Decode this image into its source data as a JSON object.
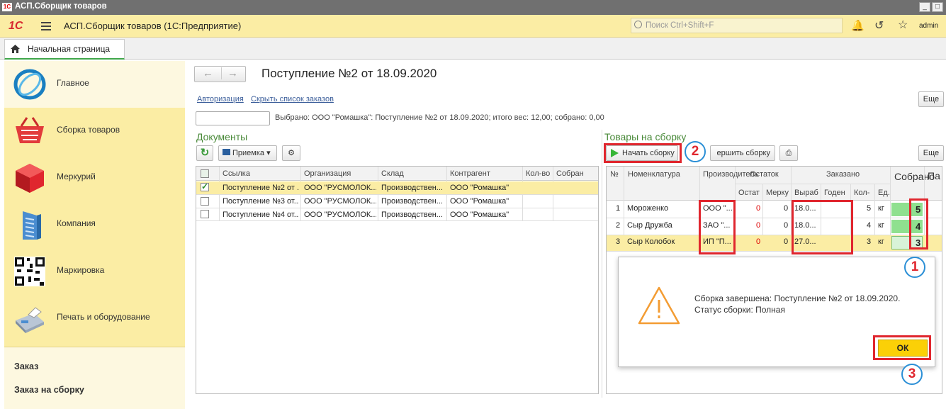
{
  "window": {
    "title": "АСП.Сборщик товаров",
    "logo": "1С",
    "controls": [
      "_",
      "□"
    ]
  },
  "app": {
    "logo": "1С",
    "title": "АСП.Сборщик товаров  (1С:Предприятие)",
    "search_placeholder": "Поиск Ctrl+Shift+F",
    "user": "admin"
  },
  "tabs": [
    {
      "label": "Начальная страница"
    }
  ],
  "sidebar": {
    "items": [
      {
        "label": "Главное",
        "icon": "globe-icon"
      },
      {
        "label": "Сборка товаров",
        "icon": "basket-icon"
      },
      {
        "label": "Меркурий",
        "icon": "cube-icon"
      },
      {
        "label": "Компания",
        "icon": "building-icon"
      },
      {
        "label": "Маркировка",
        "icon": "qr-code-icon"
      },
      {
        "label": "Печать и оборудование",
        "icon": "cash-register-icon"
      }
    ],
    "links": [
      "Заказ",
      "Заказ на сборку"
    ]
  },
  "main": {
    "title": "Поступление №2 от 18.09.2020",
    "links": {
      "auth": "Авторизация",
      "hide": "Скрыть список заказов"
    },
    "more_label": "Еще",
    "selection_info": "Выбрано: ООО \"Ромашка\": Поступление №2 от 18.09.2020; итого вес: 12,00; собрано: 0,00"
  },
  "documents": {
    "title": "Документы",
    "filter_button": "Приемка",
    "columns": [
      "Ссылка",
      "Организация",
      "Склад",
      "Контрагент",
      "Кол-во",
      "Собран"
    ],
    "rows": [
      {
        "checked": true,
        "link": "Поступление №2 от ...",
        "org": "ООО \"РУСМОЛОК...",
        "sklad": "Производствен...",
        "contr": "ООО \"Ромашка\""
      },
      {
        "checked": false,
        "link": "Поступление №3 от...",
        "org": "ООО \"РУСМОЛОК...",
        "sklad": "Производствен...",
        "contr": "ООО \"Ромашка\""
      },
      {
        "checked": false,
        "link": "Поступление №4 от...",
        "org": "ООО \"РУСМОЛОК...",
        "sklad": "Производствен...",
        "contr": "ООО \"Ромашка\""
      }
    ]
  },
  "goods": {
    "title": "Товары на сборку",
    "start_button": "Начать сборку",
    "finish_button": "ершить сборку",
    "more_label": "Еще",
    "headers": {
      "num": "№",
      "name": "Номенклатура",
      "maker": "Производитель",
      "stock": "Остаток",
      "stock_rest": "Остат",
      "stock_merc": "Мерку",
      "ordered": "Заказано",
      "made": "Выраб",
      "valid": "Годен",
      "qty": "Кол-",
      "unit": "Ед.",
      "collected": "Собрано",
      "extra": "Па"
    },
    "rows": [
      {
        "num": "1",
        "name": "Мороженко",
        "maker": "ООО \"...",
        "rest": "0",
        "merc": "0",
        "made": "18.0...",
        "valid": "",
        "qty": "5",
        "unit": "кг",
        "collected": "5"
      },
      {
        "num": "2",
        "name": "Сыр Дружба",
        "maker": "ЗАО \"...",
        "rest": "0",
        "merc": "0",
        "made": "18.0...",
        "valid": "",
        "qty": "4",
        "unit": "кг",
        "collected": "4"
      },
      {
        "num": "3",
        "name": "Сыр Колобок",
        "maker": "ИП \"П...",
        "rest": "0",
        "merc": "0",
        "made": "27.0...",
        "valid": "",
        "qty": "3",
        "unit": "кг",
        "collected": "3"
      }
    ]
  },
  "dialog": {
    "message": "Сборка завершена: Поступление №2 от 18.09.2020.",
    "status": "Статус сборки: Полная",
    "ok_label": "ОК"
  },
  "annotations": {
    "one": "1",
    "two": "2",
    "three": "3"
  },
  "colors": {
    "accent_yellow": "#fbeda4",
    "green_title": "#4a8a3a",
    "highlight_red": "#e0262e",
    "circle_blue": "#2b8fd6"
  }
}
